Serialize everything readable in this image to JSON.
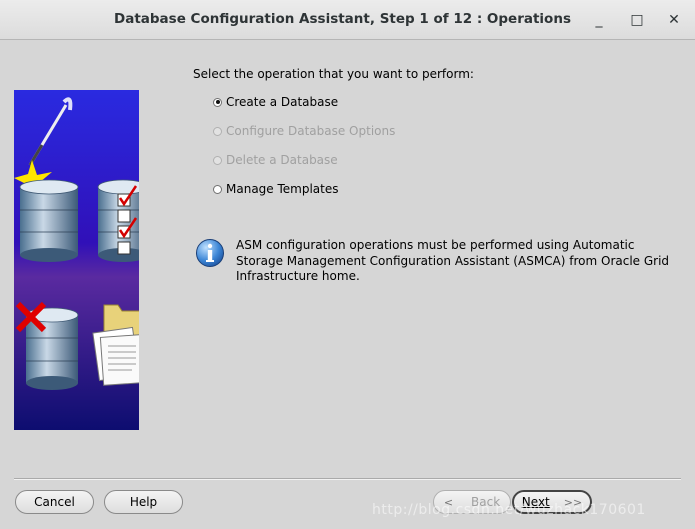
{
  "window": {
    "title": "Database Configuration Assistant, Step 1 of 12 : Operations",
    "minimize_glyph": "_",
    "maximize_glyph": "□",
    "close_glyph": "✕"
  },
  "main": {
    "heading": "Select the operation that you want to perform:",
    "options": [
      {
        "label": "Create a Database",
        "selected": true,
        "enabled": true
      },
      {
        "label": "Configure Database Options",
        "selected": false,
        "enabled": false
      },
      {
        "label": "Delete a Database",
        "selected": false,
        "enabled": false
      },
      {
        "label": "Manage Templates",
        "selected": false,
        "enabled": true
      }
    ],
    "info_icon": "info-icon",
    "info_message": "ASM configuration operations must be performed using Automatic Storage Management Configuration Assistant (ASMCA) from Oracle Grid Infrastructure home."
  },
  "footer": {
    "cancel_label": "Cancel",
    "help_label": "Help",
    "back_label": "Back",
    "next_label": "Next",
    "back_arrow": "<",
    "next_arrow": ">>"
  },
  "watermark": "http://blog.csdn.net/wuzhack170601",
  "colors": {
    "background": "#d6d6d6",
    "art_top": "#1c1cd0",
    "art_bottom": "#0e0e7a",
    "check_red": "#d40000"
  }
}
